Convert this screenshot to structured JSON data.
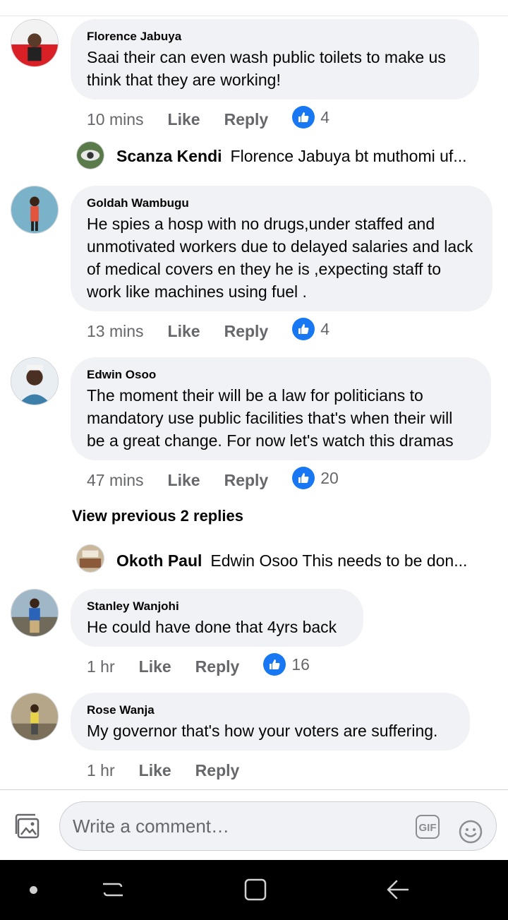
{
  "comments": [
    {
      "author": "Florence Jabuya",
      "text": "Saai their can even wash public toilets to make us think that they are working!",
      "time": "10 mins",
      "like": "Like",
      "reply": "Reply",
      "reactions": "4"
    },
    {
      "author": "Goldah Wambugu",
      "text": "He spies a hosp with no drugs,under staffed and unmotivated workers due to delayed salaries and lack of medical covers en they he is ,expecting staff to work like machines using fuel .",
      "time": "13 mins",
      "like": "Like",
      "reply": "Reply",
      "reactions": "4"
    },
    {
      "author": "Edwin Osoo",
      "text": "The moment their will be a law for politicians to mandatory use public facilities that's when their will be a great change. For now let's watch this dramas",
      "time": "47 mins",
      "like": "Like",
      "reply": "Reply",
      "reactions": "20"
    },
    {
      "author": "Stanley Wanjohi",
      "text": "He could have done that 4yrs back",
      "time": "1 hr",
      "like": "Like",
      "reply": "Reply",
      "reactions": "16"
    },
    {
      "author": "Rose Wanja",
      "text": "My governor that's how your voters are suffering.",
      "time": "1 hr",
      "like": "Like",
      "reply": "Reply"
    }
  ],
  "replies": [
    {
      "author": "Scanza Kendi",
      "text": "Florence Jabuya bt muthomi uf..."
    },
    {
      "author": "Okoth Paul",
      "text": "Edwin Osoo This needs to be don..."
    }
  ],
  "view_previous": "View previous 2 replies",
  "composer": {
    "placeholder": "Write a comment…",
    "gif": "GIF"
  },
  "colors": {
    "like_blue": "#1877f2",
    "bubble": "#f0f2f5",
    "meta": "#65676b"
  },
  "icons": [
    "photo-icon",
    "gif-icon",
    "emoji-icon",
    "like-reaction-icon",
    "recents-nav-icon",
    "home-nav-icon",
    "back-nav-icon"
  ]
}
